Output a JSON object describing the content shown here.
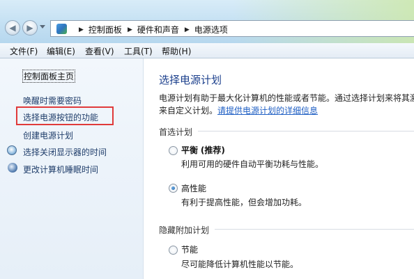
{
  "address": {
    "crumbs": [
      "控制面板",
      "硬件和声音",
      "电源选项"
    ],
    "separator": "▶"
  },
  "menu": [
    "文件(F)",
    "编辑(E)",
    "查看(V)",
    "工具(T)",
    "帮助(H)"
  ],
  "sidebar": {
    "home": "控制面板主页",
    "links": [
      "唤醒时需要密码",
      "选择电源按钮的功能",
      "创建电源计划",
      "选择关闭显示器的时间",
      "更改计算机睡眠时间"
    ],
    "highlighted_index": 1
  },
  "main": {
    "title": "选择电源计划",
    "desc_line1": "电源计划有助于最大化计算机的性能或者节能。通过选择计划来将其激",
    "desc_line2_prefix": "来自定义计划。",
    "desc_link": "请提供电源计划的详细信息",
    "preferred_heading": "首选计划",
    "hidden_heading": "隐藏附加计划",
    "plans": [
      {
        "name": "平衡",
        "tag": "(推荐)",
        "desc": "利用可用的硬件自动平衡功耗与性能。",
        "checked": false
      },
      {
        "name": "高性能",
        "tag": "",
        "desc": "有利于提高性能，但会增加功耗。",
        "checked": true
      },
      {
        "name": "节能",
        "tag": "",
        "desc": "尽可能降低计算机性能以节能。",
        "checked": false
      }
    ]
  },
  "icons": {
    "back": "back-arrow-icon",
    "forward": "forward-arrow-icon",
    "address": "control-panel-icon",
    "display": "clock-icon",
    "sleep": "moon-icon"
  },
  "colors": {
    "highlight_box": "#e03a3a",
    "title": "#1b3f8c",
    "link": "#1f5fc4"
  }
}
